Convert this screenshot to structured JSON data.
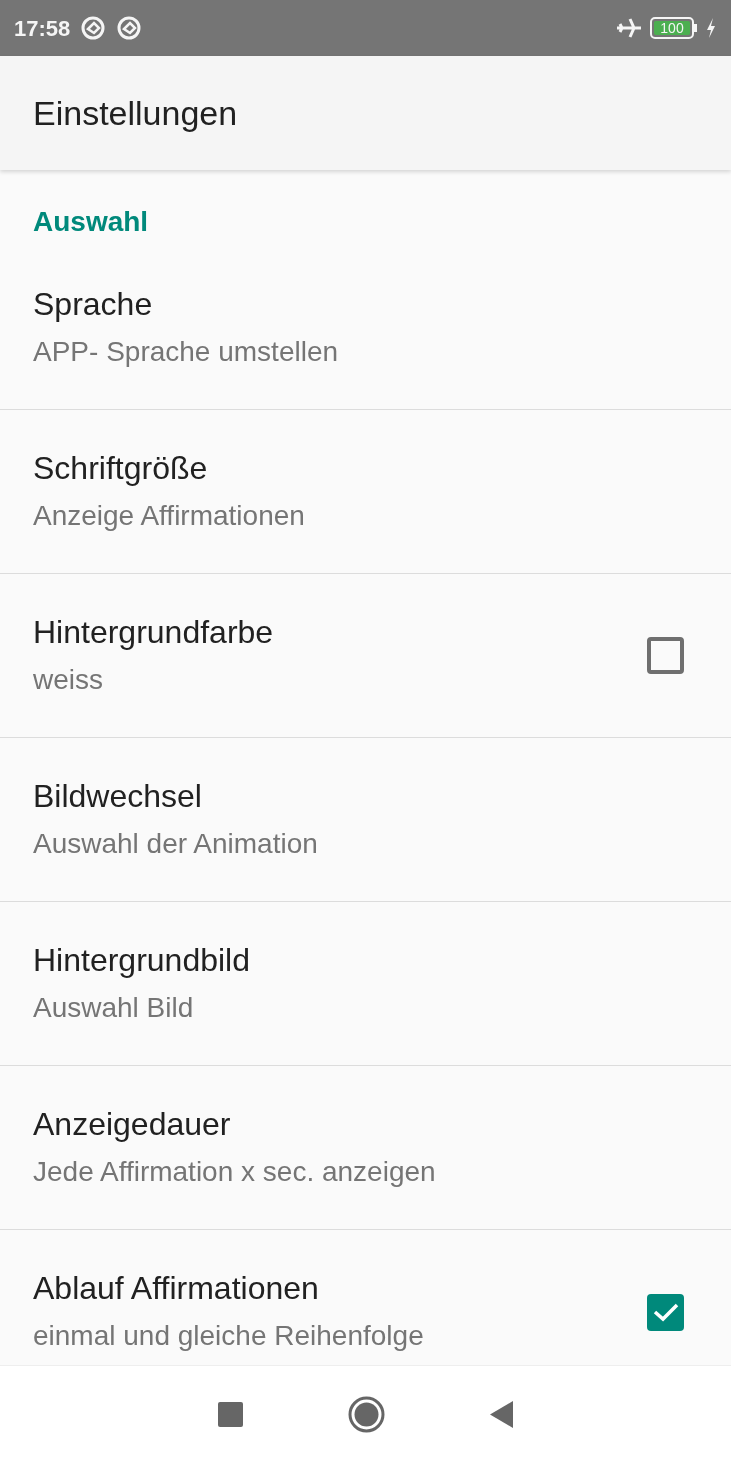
{
  "status_bar": {
    "time": "17:58",
    "battery": "100"
  },
  "app_bar": {
    "title": "Einstellungen"
  },
  "category": {
    "title": "Auswahl"
  },
  "preferences": [
    {
      "title": "Sprache",
      "summary": "APP- Sprache umstellen",
      "kind": "plain"
    },
    {
      "title": "Schriftgröße",
      "summary": "Anzeige Affirmationen",
      "kind": "plain"
    },
    {
      "title": "Hintergrundfarbe",
      "summary": "weiss",
      "kind": "checkbox",
      "checked": false
    },
    {
      "title": "Bildwechsel",
      "summary": "Auswahl der Animation",
      "kind": "plain"
    },
    {
      "title": "Hintergrundbild",
      "summary": "Auswahl Bild",
      "kind": "plain"
    },
    {
      "title": "Anzeigedauer",
      "summary": "Jede Affirmation x sec. anzeigen",
      "kind": "plain"
    },
    {
      "title": "Ablauf Affirmationen",
      "summary": "einmal und gleiche Reihenfolge",
      "kind": "checkbox",
      "checked": true
    }
  ]
}
